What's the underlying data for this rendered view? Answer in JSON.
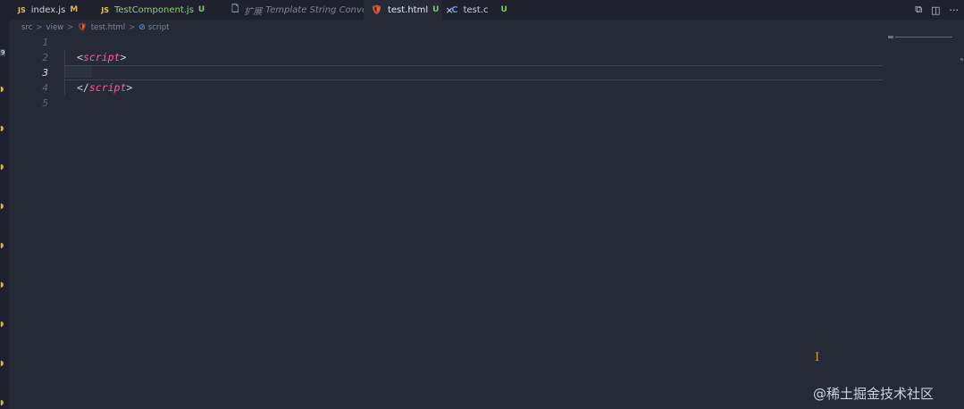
{
  "tabs": [
    {
      "icon": "JS",
      "label": "index.js",
      "status": "M"
    },
    {
      "icon": "JS",
      "label": "TestComponent.js",
      "status": "U"
    },
    {
      "prefix": "扩展",
      "label": "Template String Converter"
    },
    {
      "icon": "html",
      "label": "test.html",
      "status": "U",
      "close": "×"
    },
    {
      "icon": "C",
      "label": "test.c",
      "status": "U"
    }
  ],
  "breadcrumb": {
    "items": [
      "src",
      "view",
      "test.html",
      "script"
    ],
    "separator": ">"
  },
  "editor": {
    "line_numbers": [
      "1",
      "2",
      "3",
      "4",
      "5"
    ],
    "current_line": 3,
    "lines": [
      {
        "open": "",
        "tag": "",
        "close": ""
      },
      {
        "open": "<",
        "tag": "script",
        "close": ">"
      },
      {
        "open": "",
        "tag": "",
        "close": ""
      },
      {
        "open": "</",
        "tag": "script",
        "close": ">"
      },
      {
        "open": "",
        "tag": "",
        "close": ""
      }
    ]
  },
  "activity_badge": "9",
  "tab_actions": {
    "compare": "⧉",
    "split": "◫",
    "more": "···"
  },
  "watermark": "@稀土掘金技术社区",
  "colors": {
    "background": "#262a36",
    "tag": "#ff5c9a",
    "modified": "#e0b040",
    "untracked": "#7cc96a"
  }
}
